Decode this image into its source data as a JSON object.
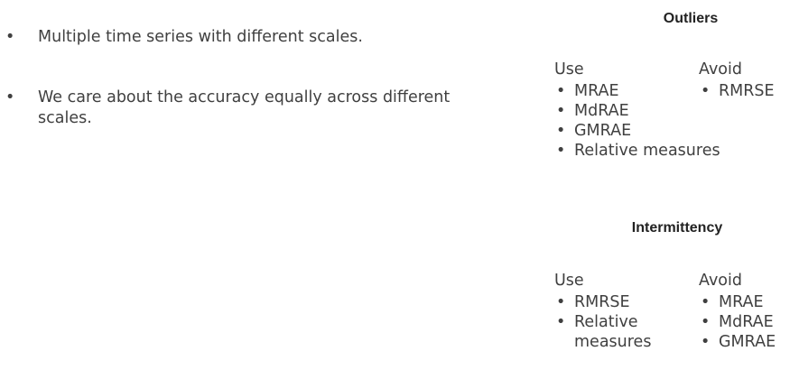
{
  "left": {
    "bullets": [
      "Multiple time series with different scales.",
      "We care about the accuracy equally across different scales."
    ]
  },
  "outliers": {
    "title": "Outliers",
    "use_label": "Use",
    "avoid_label": "Avoid",
    "use_items": [
      "MRAE",
      "MdRAE",
      "GMRAE",
      "Relative measures"
    ],
    "avoid_items": [
      "RMRSE"
    ]
  },
  "intermittency": {
    "title": "Intermittency",
    "use_label": "Use",
    "avoid_label": "Avoid",
    "use_items": [
      "RMRSE",
      "Relative",
      "measures"
    ],
    "avoid_items": [
      "MRAE",
      "MdRAE",
      "GMRAE"
    ]
  }
}
